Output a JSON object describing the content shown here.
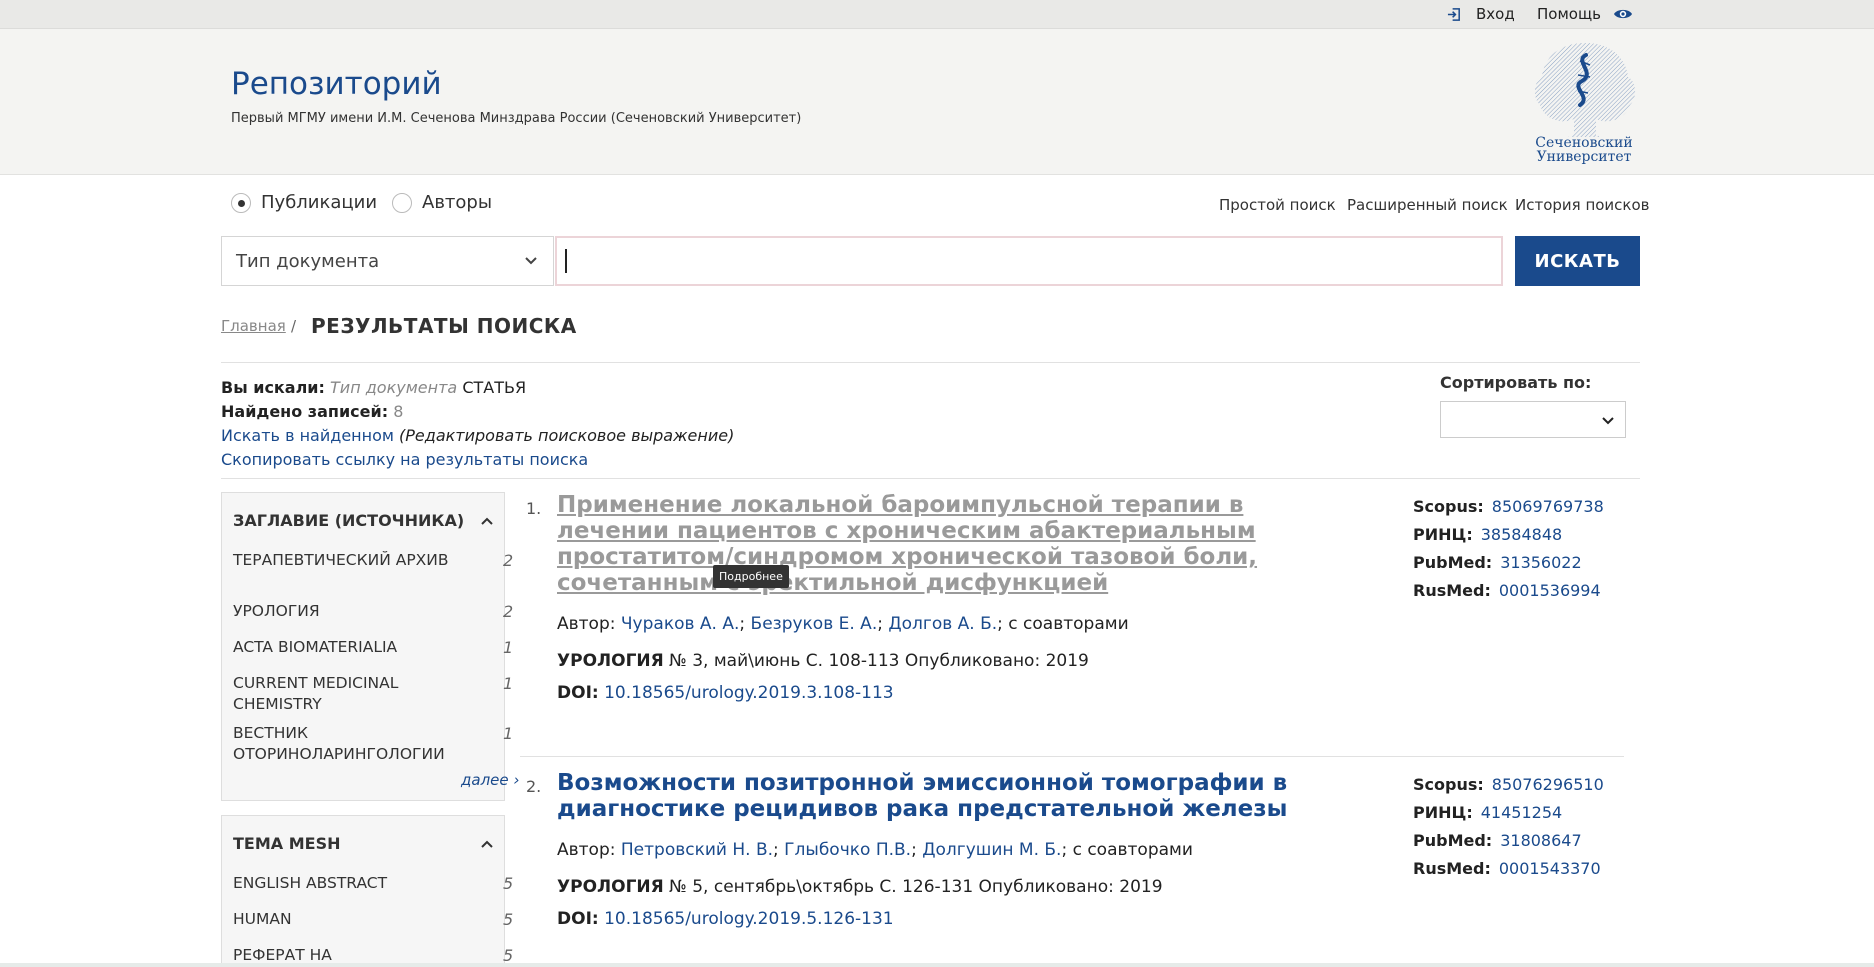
{
  "topbar": {
    "login": "Вход",
    "help": "Помощь"
  },
  "header": {
    "title": "Репозиторий",
    "subtitle": "Первый МГМУ имени И.М. Сеченова Минздрава России (Сеченовский Университет)",
    "logo_line1": "Сеченовский",
    "logo_line2": "Университет"
  },
  "search": {
    "mode_publications": "Публикации",
    "mode_authors": "Авторы",
    "simple": "Простой поиск",
    "advanced": "Расширенный поиск",
    "history": "История поисков",
    "doc_type": "Тип документа",
    "query": "",
    "button": "ИСКАТЬ"
  },
  "breadcrumb": {
    "home": "Главная",
    "sep": "/",
    "current": "РЕЗУЛЬТАТЫ ПОИСКА"
  },
  "summary": {
    "searched_label": "Вы искали:",
    "searched_field": "Тип документа",
    "searched_value": "СТАТЬЯ",
    "found_label": "Найдено записей:",
    "found_count": "8",
    "refine_link": "Искать в найденном",
    "refine_edit": "(Редактировать поисковое выражение)",
    "copy_link": "Скопировать ссылку на результаты поиска"
  },
  "sort": {
    "label": "Сортировать по:",
    "value": ""
  },
  "facets": [
    {
      "title": "ЗАГЛАВИЕ (ИСТОЧНИКА)",
      "items": [
        {
          "label": "ТЕРАПЕВТИЧЕСКИЙ АРХИВ",
          "count": "2"
        },
        {
          "label": "УРОЛОГИЯ",
          "count": "2"
        },
        {
          "label": "ACTA BIOMATERIALIA",
          "count": "1"
        },
        {
          "label": "CURRENT MEDICINAL CHEMISTRY",
          "count": "1"
        },
        {
          "label": "ВЕСТНИК ОТОРИНОЛАРИНГОЛОГИИ",
          "count": "1"
        }
      ],
      "more": "далее ›"
    },
    {
      "title": "ТЕМА MESH",
      "items": [
        {
          "label": "ENGLISH ABSTRACT",
          "count": "5"
        },
        {
          "label": "HUMAN",
          "count": "5"
        },
        {
          "label": "РЕФЕРАТ НА",
          "count": "5"
        }
      ]
    }
  ],
  "tooltip": "Подробнее",
  "results": [
    {
      "num": "1.",
      "title": "Применение локальной бароимпульсной терапии в лечении пациентов с хроническим абактериальным простатитом/синдромом хронической тазовой боли, сочетанным с эректильной дисфункцией",
      "author_label": "Автор:",
      "authors": [
        "Чураков А. А.",
        "Безруков Е. А.",
        "Долгов А. Б."
      ],
      "coauthors": "; с соавторами",
      "journal": "УРОЛОГИЯ",
      "issue": " № 3, май\\июнь С. 108-113 Опубликовано: 2019",
      "doi_label": "DOI:",
      "doi": "10.18565/urology.2019.3.108-113",
      "ids": [
        {
          "label": "Scopus:",
          "value": "85069769738"
        },
        {
          "label": "РИНЦ:",
          "value": "38584848"
        },
        {
          "label": "PubMed:",
          "value": "31356022"
        },
        {
          "label": "RusMed:",
          "value": "0001536994"
        }
      ]
    },
    {
      "num": "2.",
      "title": "Возможности позитронной эмиссионной томографии в диагностике рецидивов рака предстательной железы",
      "author_label": "Автор:",
      "authors": [
        "Петровский Н. В.",
        "Глыбочко П.В.",
        "Долгушин М. Б."
      ],
      "coauthors": "; с соавторами",
      "journal": "УРОЛОГИЯ",
      "issue": " № 5, сентябрь\\октябрь С. 126-131 Опубликовано: 2019",
      "doi_label": "DOI:",
      "doi": "10.18565/urology.2019.5.126-131",
      "ids": [
        {
          "label": "Scopus:",
          "value": "85076296510"
        },
        {
          "label": "РИНЦ:",
          "value": "41451254"
        },
        {
          "label": "PubMed:",
          "value": "31808647"
        },
        {
          "label": "RusMed:",
          "value": "0001543370"
        }
      ]
    }
  ],
  "colors": {
    "brand": "#1a4a8c",
    "visited": "#9a9a9a",
    "header_bg": "#f4f4f2"
  },
  "icons": {
    "login": "login-icon",
    "help": "eye-icon",
    "dropdown": "chevron-down-icon",
    "collapse": "chevron-up-icon"
  }
}
